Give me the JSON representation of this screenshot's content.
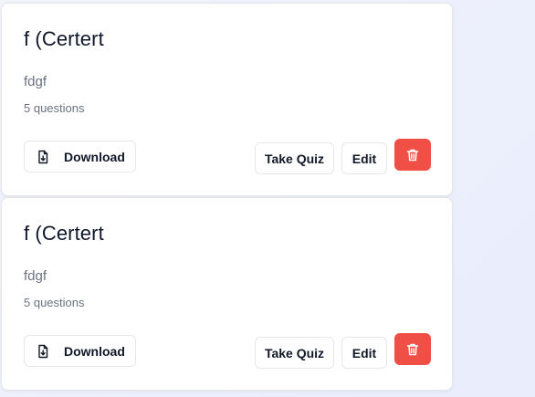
{
  "quizzes": [
    {
      "title": "f (Certert",
      "description": "fdgf",
      "question_count": "5 questions",
      "download_label": "Download",
      "take_quiz_label": "Take Quiz",
      "edit_label": "Edit",
      "download_icon": "file-download-icon",
      "delete_icon": "trash-icon"
    },
    {
      "title": "f (Certert",
      "description": "fdgf",
      "question_count": "5 questions",
      "download_label": "Download",
      "take_quiz_label": "Take Quiz",
      "edit_label": "Edit",
      "download_icon": "file-download-icon",
      "delete_icon": "trash-icon"
    }
  ],
  "colors": {
    "delete_button": "#ef4f45",
    "card_border": "#e5e7eb",
    "background": "#eceffc"
  }
}
